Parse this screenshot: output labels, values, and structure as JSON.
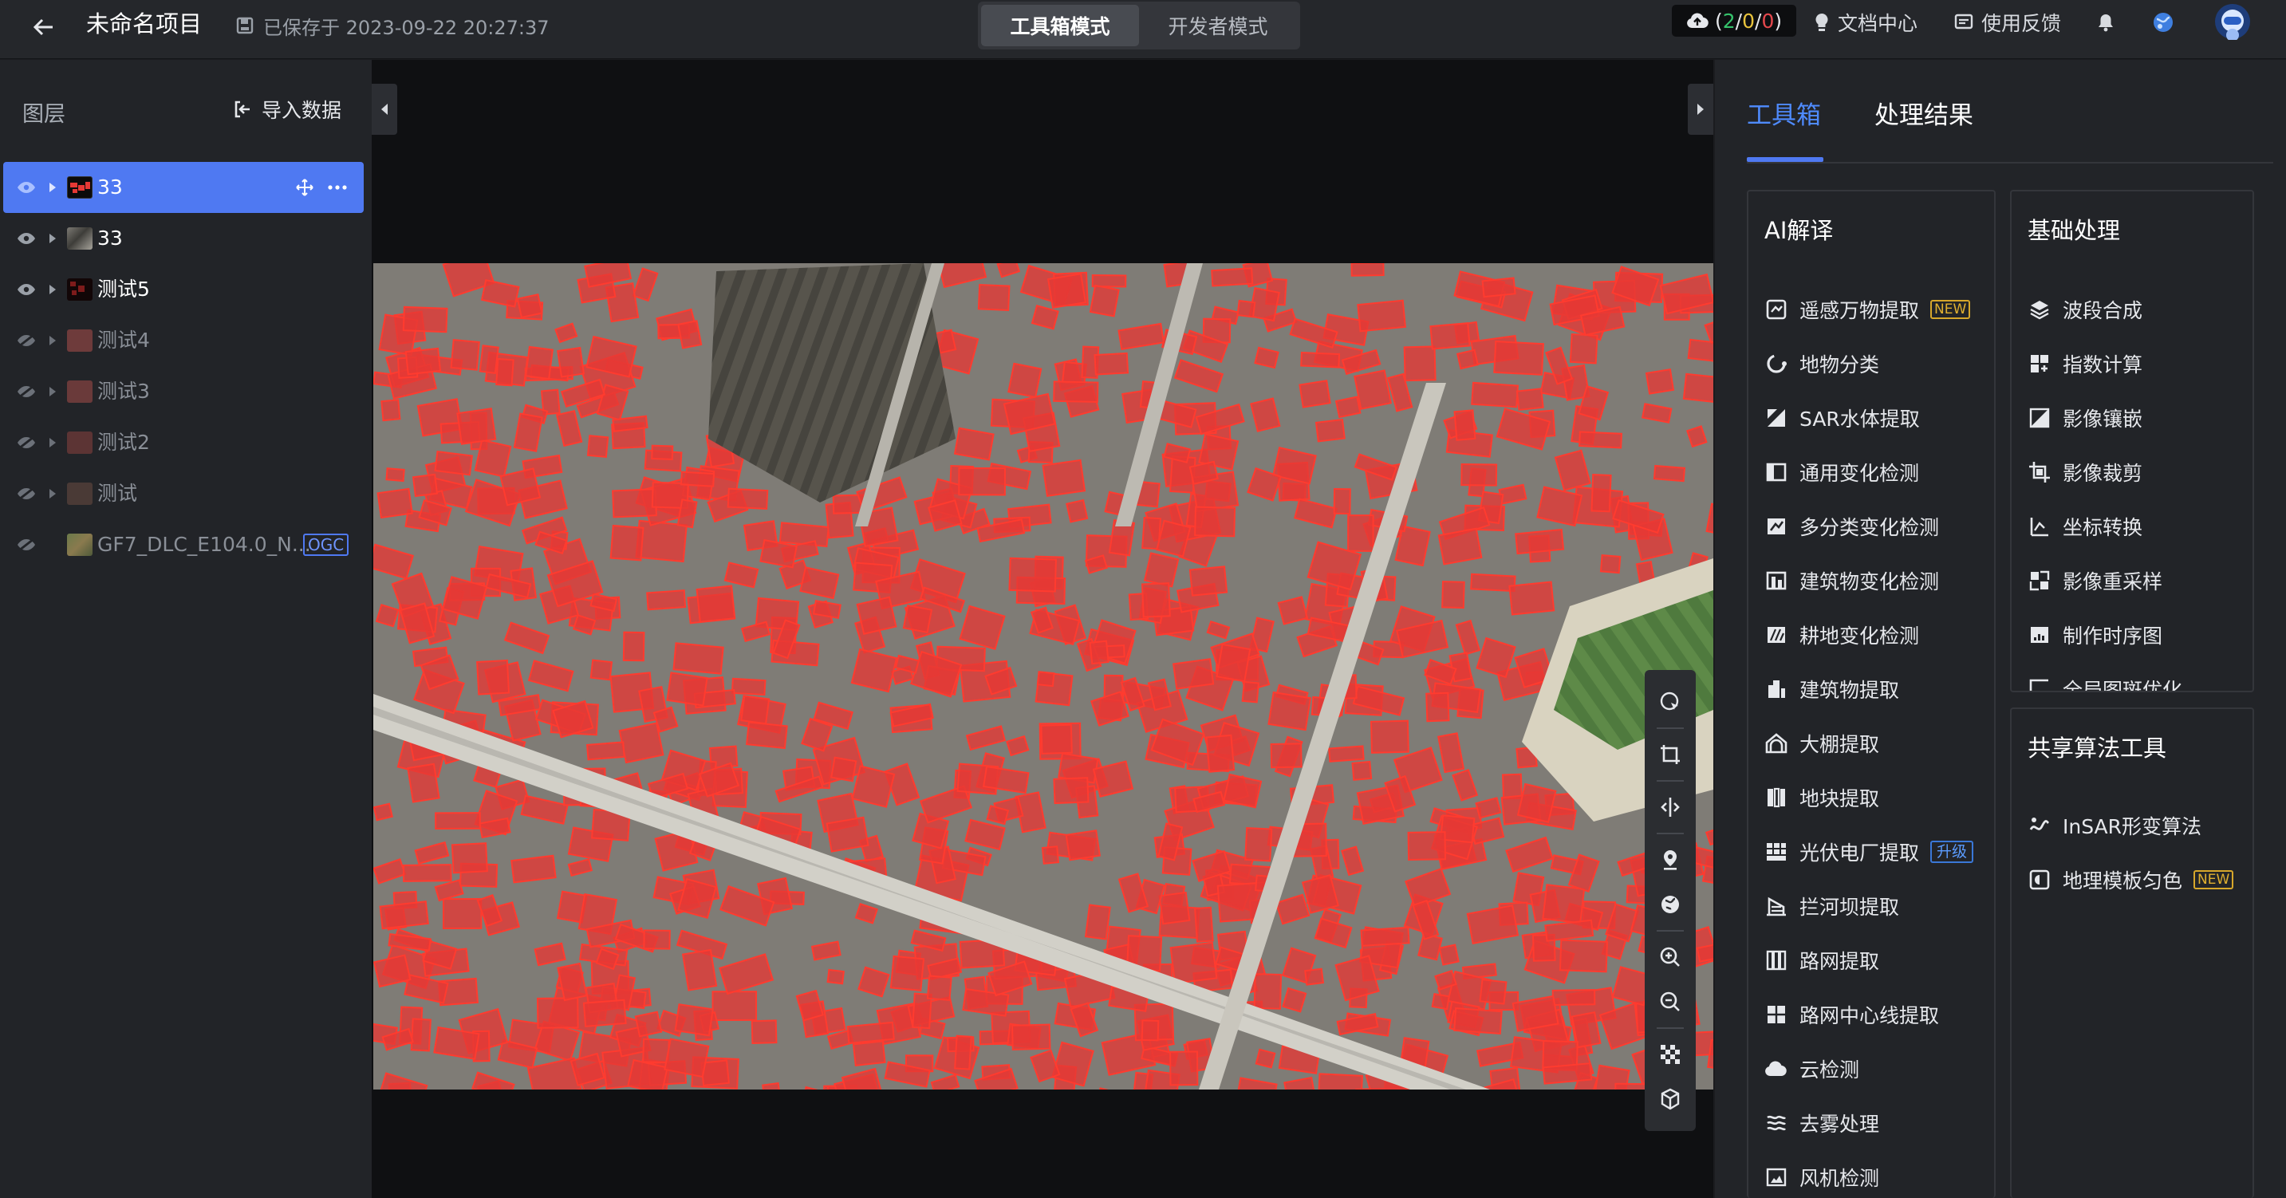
{
  "header": {
    "project_title": "未命名项目",
    "save_status": "已保存于 2023-09-22 20:27:37",
    "modes": [
      "工具箱模式",
      "开发者模式"
    ],
    "active_mode": "工具箱模式",
    "task_counter": {
      "running": "2",
      "queued": "0",
      "failed": "0"
    },
    "docs_label": "文档中心",
    "feedback_label": "使用反馈",
    "icons": [
      "back-arrow-icon",
      "save-icon",
      "cloud-upload-icon",
      "bulb-icon",
      "feedback-icon",
      "bell-icon",
      "globe-icon",
      "user-avatar"
    ]
  },
  "layers_panel": {
    "title": "图层",
    "import_label": "导入数据",
    "layers": [
      {
        "name": "33",
        "visible": true,
        "selected": true,
        "dim": false
      },
      {
        "name": "33",
        "visible": true,
        "selected": false,
        "dim": false
      },
      {
        "name": "测试5",
        "visible": true,
        "selected": false,
        "dim": false
      },
      {
        "name": "测试4",
        "visible": false,
        "selected": false,
        "dim": true
      },
      {
        "name": "测试3",
        "visible": false,
        "selected": false,
        "dim": true
      },
      {
        "name": "测试2",
        "visible": false,
        "selected": false,
        "dim": true
      },
      {
        "name": "测试",
        "visible": false,
        "selected": false,
        "dim": true
      },
      {
        "name": "GF7_DLC_E104.0_N...",
        "visible": false,
        "selected": false,
        "dim": true,
        "badge": "OGC"
      }
    ]
  },
  "right_panel": {
    "tabs": [
      "工具箱",
      "处理结果"
    ],
    "active_tab": "工具箱",
    "ai_card": {
      "title": "AI解译",
      "items": [
        {
          "label": "遥感万物提取",
          "badge": "NEW",
          "badge_type": "new"
        },
        {
          "label": "地物分类"
        },
        {
          "label": "SAR水体提取"
        },
        {
          "label": "通用变化检测"
        },
        {
          "label": "多分类变化检测"
        },
        {
          "label": "建筑物变化检测"
        },
        {
          "label": "耕地变化检测"
        },
        {
          "label": "建筑物提取"
        },
        {
          "label": "大棚提取"
        },
        {
          "label": "地块提取"
        },
        {
          "label": "光伏电厂提取",
          "badge": "升级",
          "badge_type": "upgrade"
        },
        {
          "label": "拦河坝提取"
        },
        {
          "label": "路网提取"
        },
        {
          "label": "路网中心线提取"
        },
        {
          "label": "云检测"
        },
        {
          "label": "去雾处理"
        },
        {
          "label": "风机检测"
        }
      ]
    },
    "basic_card": {
      "title": "基础处理",
      "items": [
        {
          "label": "波段合成"
        },
        {
          "label": "指数计算"
        },
        {
          "label": "影像镶嵌"
        },
        {
          "label": "影像裁剪"
        },
        {
          "label": "坐标转换"
        },
        {
          "label": "影像重采样"
        },
        {
          "label": "制作时序图"
        },
        {
          "label": "全局图斑优化"
        }
      ]
    },
    "shared_card": {
      "title": "共享算法工具",
      "items": [
        {
          "label": "InSAR形变算法"
        },
        {
          "label": "地理模板匀色",
          "badge": "NEW",
          "badge_type": "new"
        }
      ]
    }
  },
  "map": {
    "overlay_color": "#e53935",
    "tools": [
      "select-icon",
      "crop-icon",
      "split-compare-icon",
      "location-icon",
      "globe-icon",
      "zoom-in-icon",
      "zoom-out-icon",
      "mosaic-icon",
      "3d-box-icon"
    ]
  }
}
